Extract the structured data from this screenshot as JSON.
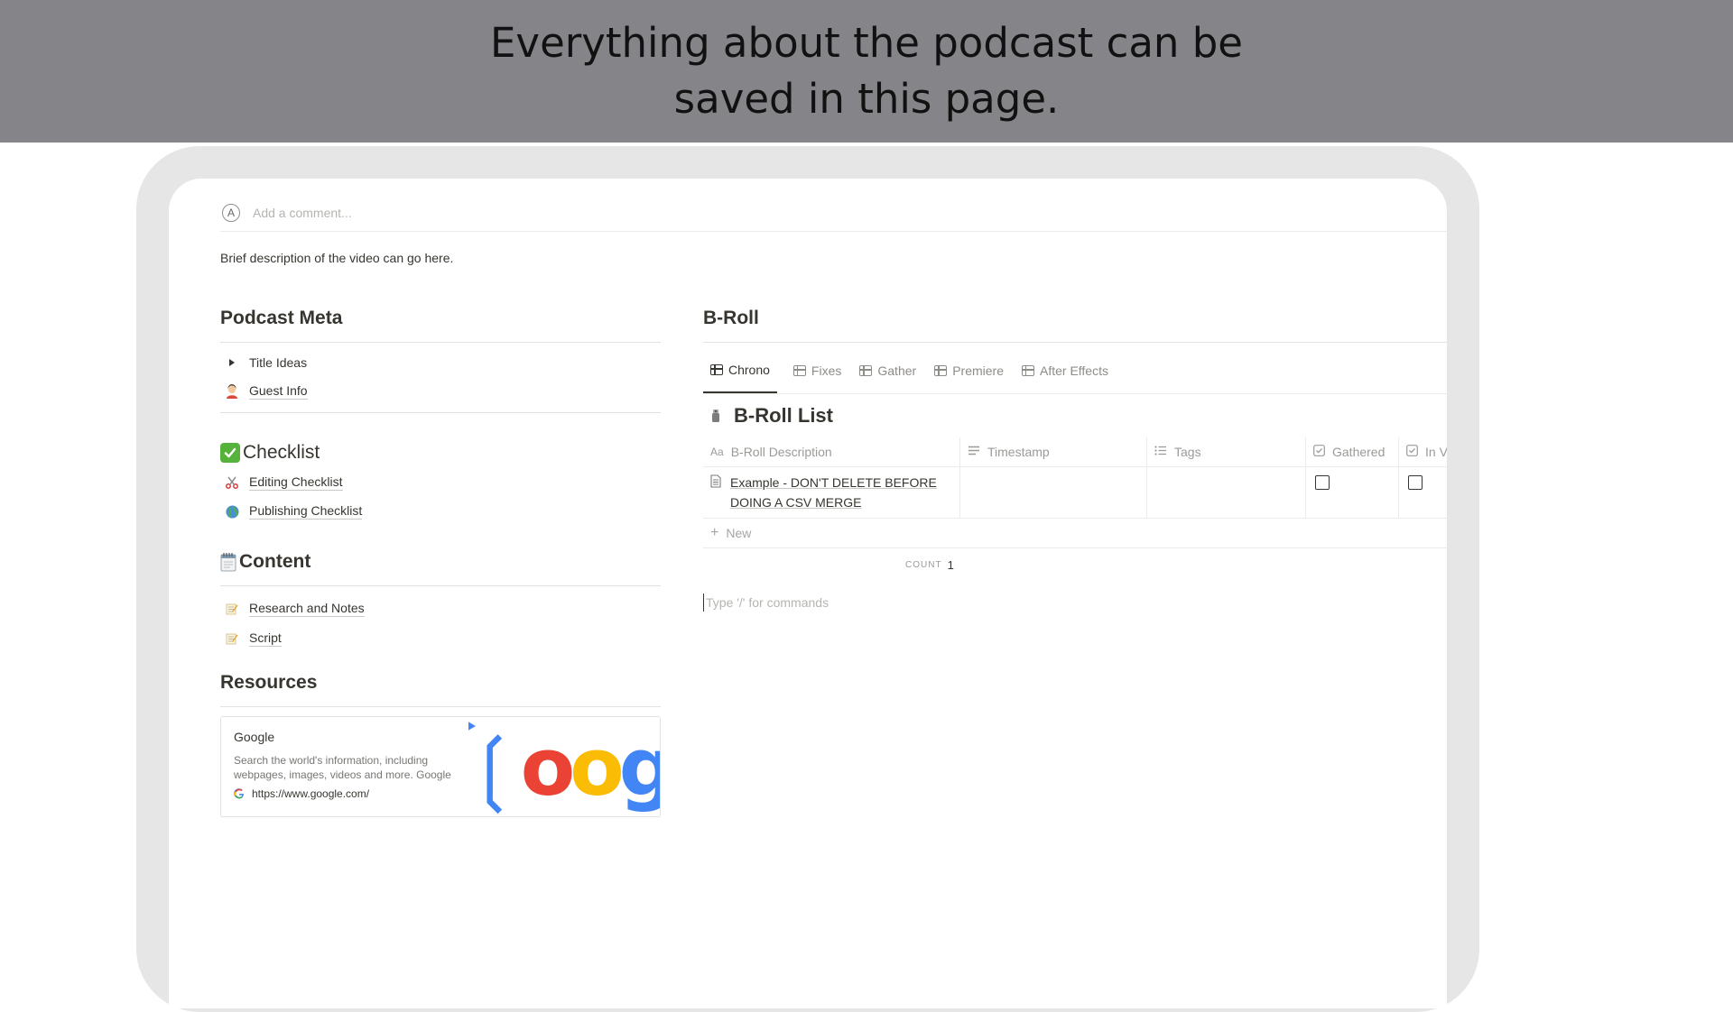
{
  "banner": {
    "line1": "Everything about the podcast can be",
    "line2": "saved in this page."
  },
  "comment": {
    "avatar_letter": "A",
    "placeholder": "Add a comment..."
  },
  "description": "Brief description of the video can go here.",
  "left": {
    "podcast_meta": {
      "heading": "Podcast Meta",
      "items": [
        {
          "label": "Title Ideas",
          "icon": "toggle-triangle-icon"
        },
        {
          "label": "Guest Info",
          "icon": "person-icon"
        }
      ]
    },
    "checklist": {
      "heading": "Checklist",
      "icon": "check-mark-button-icon",
      "items": [
        {
          "label": "Editing Checklist",
          "icon": "scissors-icon"
        },
        {
          "label": "Publishing Checklist",
          "icon": "globe-icon"
        }
      ]
    },
    "content": {
      "heading": "Content",
      "icon": "spiral-notepad-icon",
      "items": [
        {
          "label": "Research and Notes",
          "icon": "memo-icon"
        },
        {
          "label": "Script",
          "icon": "memo-icon"
        }
      ]
    },
    "resources": {
      "heading": "Resources",
      "bookmark": {
        "title": "Google",
        "description": "Search the world's information, including webpages, images, videos and more. Google",
        "url": "https://www.google.com/",
        "image_text": "oogl",
        "colors": {
          "blue": "#4285f4",
          "red": "#ea4335",
          "yellow": "#fbbc05",
          "green": "#34a853"
        }
      }
    }
  },
  "broll": {
    "heading": "B-Roll",
    "tabs": [
      {
        "label": "Chrono",
        "active": true
      },
      {
        "label": "Fixes"
      },
      {
        "label": "Gather"
      },
      {
        "label": "Premiere"
      },
      {
        "label": "After Effects"
      }
    ],
    "db_title": "B-Roll List",
    "columns": [
      {
        "label": "B-Roll Description",
        "prefix": "Aa"
      },
      {
        "label": "Timestamp",
        "icon": "text-lines-icon"
      },
      {
        "label": "Tags",
        "icon": "list-icon"
      },
      {
        "label": "Gathered",
        "icon": "checkbox-icon"
      },
      {
        "label": "In V",
        "icon": "checkbox-icon"
      }
    ],
    "rows": [
      {
        "title": "Example - DON'T DELETE BEFORE DOING A CSV MERGE",
        "gathered": false,
        "in_v": false
      }
    ],
    "new_label": "New",
    "count_label": "COUNT",
    "count_value": "1",
    "command_placeholder": "Type '/' for commands"
  }
}
